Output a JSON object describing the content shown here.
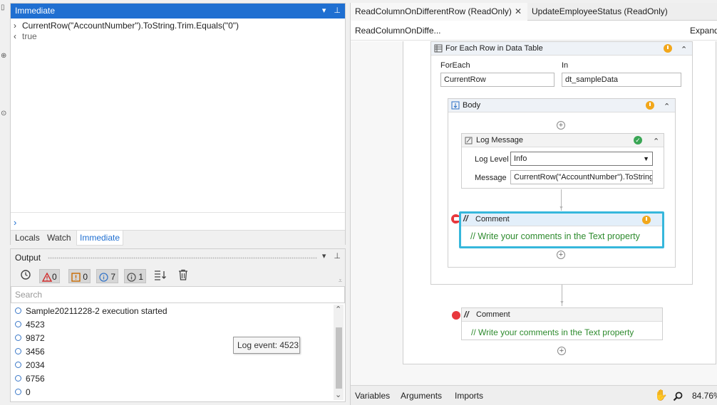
{
  "immediate_pane": {
    "title": "Immediate",
    "dropdown_icon": "chevron-down-icon",
    "pin_icon": "pin-icon",
    "lines": [
      {
        "prefix": "›",
        "text": "CurrentRow(\"AccountNumber\").ToString.Trim.Equals(\"0\")"
      },
      {
        "prefix": "‹",
        "text": "true"
      }
    ],
    "prompt": "›"
  },
  "bottom_tabs": [
    {
      "label": "Locals"
    },
    {
      "label": "Watch"
    },
    {
      "label": "Immediate",
      "active": true
    }
  ],
  "output_pane": {
    "title": "Output",
    "toolbar": {
      "errors_count": "0",
      "warnings_count": "0",
      "info_count": "7",
      "trace_count": "1"
    },
    "search_placeholder": "Search",
    "rows": [
      "Sample20211228-2 execution started",
      "4523",
      "9872",
      "3456",
      "2034",
      "6756",
      "0"
    ],
    "tooltip": "Log event: 4523"
  },
  "designer": {
    "tabs": [
      {
        "label": "ReadColumnOnDifferentRow (ReadOnly)",
        "active": true
      },
      {
        "label": "UpdateEmployeeStatus (ReadOnly)"
      }
    ],
    "close_icon": "close-icon",
    "breadcrumb": "ReadColumnOnDiffe...",
    "expand_label": "Expand",
    "for_each": {
      "title": "For Each Row in Data Table",
      "foreach_label": "ForEach",
      "foreach_value": "CurrentRow",
      "in_label": "In",
      "in_value": "dt_sampleData"
    },
    "body": {
      "title": "Body"
    },
    "log_message": {
      "title": "Log Message",
      "level_label": "Log Level",
      "level_value": "Info",
      "message_label": "Message",
      "message_value": "CurrentRow(\"AccountNumber\").ToString.Tri"
    },
    "comment_selected": {
      "title": "Comment",
      "text": "// Write your comments in the Text property",
      "border_color": "#36b7dc"
    },
    "comment_outer": {
      "title": "Comment",
      "text": "// Write your comments in the Text property"
    },
    "colors": {
      "accent": "#1f6fd1",
      "comment_green": "#2e8b2e",
      "breakpoint_red": "#e8383d",
      "timer_orange": "#f2a71b"
    }
  },
  "status_bar": {
    "variables": "Variables",
    "arguments": "Arguments",
    "imports": "Imports",
    "hand_icon": "hand-pan-icon",
    "zoom_icon": "magnifier-icon",
    "zoom": "84.76%"
  }
}
